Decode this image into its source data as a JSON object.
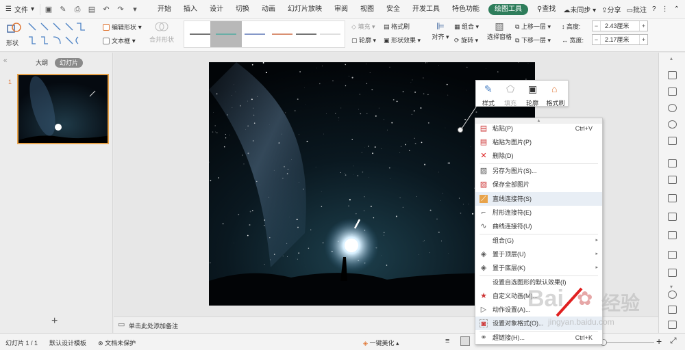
{
  "menubar": {
    "file": "文件",
    "tabs": [
      "开始",
      "插入",
      "设计",
      "切换",
      "动画",
      "幻灯片放映",
      "审阅",
      "视图",
      "安全",
      "开发工具",
      "特色功能",
      "绘图工具"
    ],
    "active_tab": "绘图工具",
    "search": "查找",
    "sync": "未同步",
    "share": "分享",
    "comment": "批注",
    "help": "?"
  },
  "ribbon": {
    "shape": "形状",
    "edit_shape": "编辑形状",
    "text_box": "文本框",
    "merge_shape": "合并形状",
    "fill": "填充",
    "format_brush": "格式刷",
    "outline": "轮廓",
    "shape_effect": "形状效果",
    "align": "对齐",
    "group": "组合",
    "rotate": "旋转",
    "selection_pane": "选择窗格",
    "bring_forward": "上移一层",
    "send_backward": "下移一层",
    "height_label": "高度:",
    "height_value": "2.43厘米",
    "width_label": "宽度:",
    "width_value": "2.17厘米"
  },
  "leftpane": {
    "outline_tab": "大纲",
    "slides_tab": "幻灯片",
    "slide_number": "1",
    "add": "+"
  },
  "notes": {
    "placeholder": "单击此处添加备注"
  },
  "minitoolbar": {
    "style": "样式",
    "fill": "填充",
    "outline": "轮廓",
    "format_brush": "格式刷"
  },
  "context_menu": {
    "items": [
      {
        "label": "粘贴(P)",
        "shortcut": "Ctrl+V",
        "icon": "paste-icon"
      },
      {
        "label": "粘贴为图片(P)",
        "shortcut": "",
        "icon": "paste-picture-icon"
      },
      {
        "label": "删除(D)",
        "shortcut": "",
        "icon": "delete-icon"
      },
      {
        "label": "另存为图片(S)...",
        "shortcut": "",
        "icon": "save-picture-icon"
      },
      {
        "label": "保存全部图片",
        "shortcut": "",
        "icon": "save-all-icon"
      },
      {
        "label": "直线连接符(S)",
        "shortcut": "",
        "icon": "straight-connector-icon"
      },
      {
        "label": "肘形连接符(E)",
        "shortcut": "",
        "icon": "elbow-connector-icon"
      },
      {
        "label": "曲线连接符(U)",
        "shortcut": "",
        "icon": "curve-connector-icon"
      },
      {
        "label": "组合(G)",
        "shortcut": "",
        "icon": ""
      },
      {
        "label": "置于顶层(U)",
        "shortcut": "",
        "icon": "bring-to-front-icon"
      },
      {
        "label": "置于底层(K)",
        "shortcut": "",
        "icon": "send-to-back-icon"
      },
      {
        "label": "设置自选图形的默认效果(I)",
        "shortcut": "",
        "icon": ""
      },
      {
        "label": "自定义动画(M)...",
        "shortcut": "",
        "icon": "custom-animation-icon"
      },
      {
        "label": "动作设置(A)...",
        "shortcut": "",
        "icon": "action-icon"
      },
      {
        "label": "设置对象格式(O)...",
        "shortcut": "",
        "icon": "format-object-icon"
      },
      {
        "label": "超链接(H)...",
        "shortcut": "Ctrl+K",
        "icon": "hyperlink-icon"
      }
    ]
  },
  "statusbar": {
    "slide_info": "幻灯片 1 / 1",
    "template": "默认设计模板",
    "protection": "文档未保护",
    "beautify": "一键美化"
  },
  "watermark": {
    "brand": "Bai",
    "brand2": "经验",
    "url": "jingyan.baidu.com"
  },
  "colors": {
    "accent": "#2e7d5b",
    "selection": "#e8a34a"
  }
}
